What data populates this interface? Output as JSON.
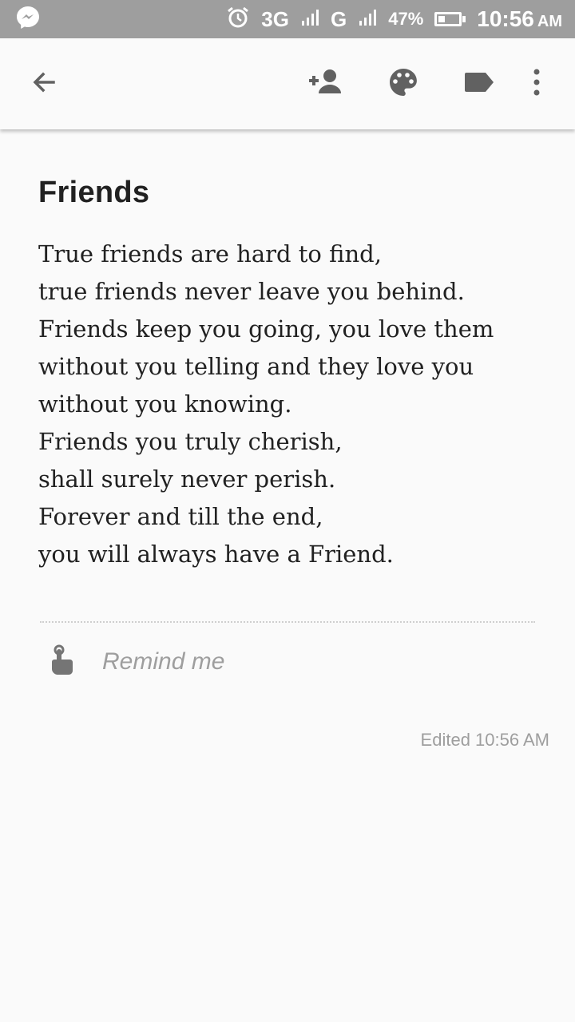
{
  "status_bar": {
    "network_3g": "3G",
    "network_g": "G",
    "battery_percent": "47%",
    "time": "10:56",
    "ampm": "AM",
    "battery_level": 0.47
  },
  "toolbar": {
    "icons": [
      "back-arrow-icon",
      "add-person-icon",
      "palette-icon",
      "label-icon",
      "more-vert-icon"
    ]
  },
  "note": {
    "title": "Friends",
    "lines": [
      "True friends are hard to find,",
      "true friends never leave you behind.",
      "Friends keep you going, you love them",
      "without you telling and they love you",
      "without you knowing.",
      "Friends you truly cherish,",
      "shall surely never perish.",
      "Forever and till the end,",
      "you will always have a Friend."
    ]
  },
  "reminder": {
    "label": "Remind me"
  },
  "footer": {
    "edited": "Edited 10:56 AM"
  }
}
